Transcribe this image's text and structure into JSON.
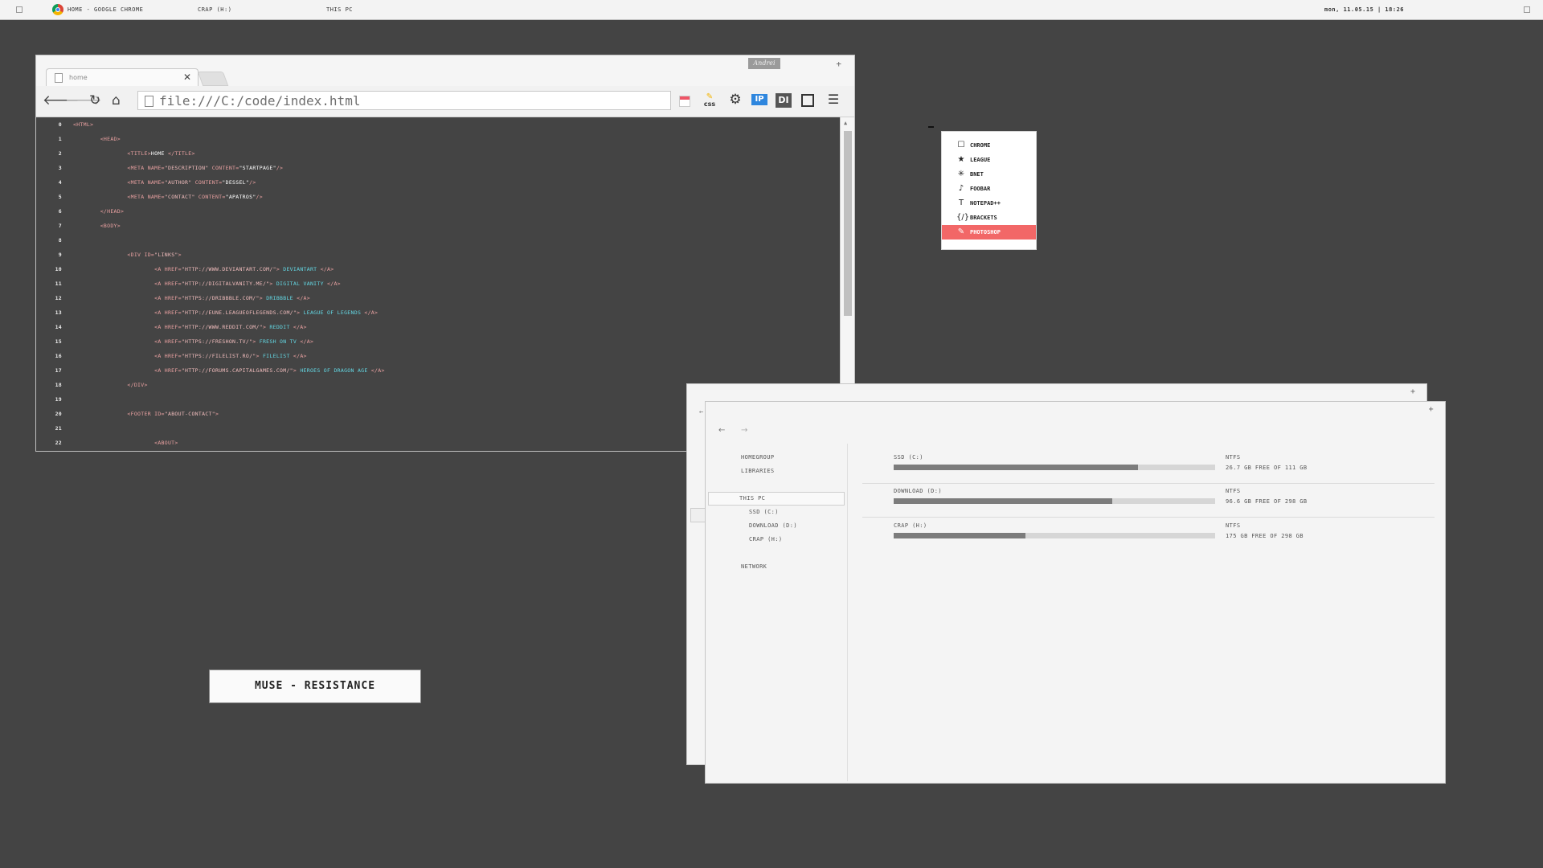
{
  "taskbar": {
    "active_window": "HOME - GOOGLE CHROME",
    "items": [
      "CRAP (H:)",
      "THIS PC"
    ],
    "datetime": "mon, 11.05.15 | 18:26"
  },
  "browser": {
    "tab_title": "home",
    "user_button": "Andrei",
    "url": "file:///C:/code/index.html",
    "extensions": [
      "calendar-icon",
      "css-icon",
      "gear-icon",
      "ip-icon",
      "di-icon",
      "fullscreen-icon",
      "menu-icon"
    ]
  },
  "editor": {
    "lines": [
      {
        "n": "0",
        "segments": [
          {
            "t": "<HTML>",
            "c": "tag"
          }
        ]
      },
      {
        "n": "1",
        "segments": [
          {
            "t": "        <HEAD>",
            "c": "tag"
          }
        ]
      },
      {
        "n": "2",
        "segments": [
          {
            "t": "                <TITLE>",
            "c": "tag"
          },
          {
            "t": "HOME",
            "c": "txt"
          },
          {
            "t": " </TITLE>",
            "c": "tag"
          }
        ]
      },
      {
        "n": "3",
        "segments": [
          {
            "t": "                <META NAME=",
            "c": "tag"
          },
          {
            "t": "\"DESCRIPTION\"",
            "c": "str"
          },
          {
            "t": " CONTENT=",
            "c": "tag"
          },
          {
            "t": "\"STARTPAGE\"",
            "c": "txt"
          },
          {
            "t": "/>",
            "c": "tag"
          }
        ]
      },
      {
        "n": "4",
        "segments": [
          {
            "t": "                <META NAME=",
            "c": "tag"
          },
          {
            "t": "\"AUTHOR\"",
            "c": "str"
          },
          {
            "t": " CONTENT=",
            "c": "tag"
          },
          {
            "t": "\"DESSEL\"",
            "c": "txt"
          },
          {
            "t": "/>",
            "c": "tag"
          }
        ]
      },
      {
        "n": "5",
        "segments": [
          {
            "t": "                <META NAME=",
            "c": "tag"
          },
          {
            "t": "\"CONTACT\"",
            "c": "str"
          },
          {
            "t": " CONTENT=",
            "c": "tag"
          },
          {
            "t": "\"APATROS\"",
            "c": "txt"
          },
          {
            "t": "/>",
            "c": "tag"
          }
        ]
      },
      {
        "n": "6",
        "segments": [
          {
            "t": "        </HEAD>",
            "c": "tag"
          }
        ]
      },
      {
        "n": "7",
        "segments": [
          {
            "t": "        <BODY>",
            "c": "tag"
          }
        ]
      },
      {
        "n": "8",
        "segments": []
      },
      {
        "n": "9",
        "segments": [
          {
            "t": "                <DIV ID=",
            "c": "tag"
          },
          {
            "t": "\"LINKS\"",
            "c": "str"
          },
          {
            "t": ">",
            "c": "tag"
          }
        ]
      },
      {
        "n": "10",
        "segments": [
          {
            "t": "                        <A HREF=",
            "c": "tag"
          },
          {
            "t": "\"HTTP://WWW.DEVIANTART.COM/\"",
            "c": "str"
          },
          {
            "t": "> ",
            "c": "tag"
          },
          {
            "t": "DEVIANTART",
            "c": "link"
          },
          {
            "t": " </A>",
            "c": "tag"
          }
        ]
      },
      {
        "n": "11",
        "segments": [
          {
            "t": "                        <A HREF=",
            "c": "tag"
          },
          {
            "t": "\"HTTP://DIGITALVANITY.ME/\"",
            "c": "str"
          },
          {
            "t": "> ",
            "c": "tag"
          },
          {
            "t": "DIGITAL VANITY",
            "c": "link"
          },
          {
            "t": " </A>",
            "c": "tag"
          }
        ]
      },
      {
        "n": "12",
        "segments": [
          {
            "t": "                        <A HREF=",
            "c": "tag"
          },
          {
            "t": "\"HTTPS://DRIBBBLE.COM/\"",
            "c": "str"
          },
          {
            "t": "> ",
            "c": "tag"
          },
          {
            "t": "DRIBBBLE",
            "c": "link"
          },
          {
            "t": " </A>",
            "c": "tag"
          }
        ]
      },
      {
        "n": "13",
        "segments": [
          {
            "t": "                        <A HREF=",
            "c": "tag"
          },
          {
            "t": "\"HTTP://EUNE.LEAGUEOFLEGENDS.COM/\"",
            "c": "str"
          },
          {
            "t": "> ",
            "c": "tag"
          },
          {
            "t": "LEAGUE OF LEGENDS",
            "c": "link"
          },
          {
            "t": " </A>",
            "c": "tag"
          }
        ]
      },
      {
        "n": "14",
        "segments": [
          {
            "t": "                        <A HREF=",
            "c": "tag"
          },
          {
            "t": "\"HTTP://WWW.REDDIT.COM/\"",
            "c": "str"
          },
          {
            "t": "> ",
            "c": "tag"
          },
          {
            "t": "REDDIT",
            "c": "link"
          },
          {
            "t": " </A>",
            "c": "tag"
          }
        ]
      },
      {
        "n": "15",
        "segments": [
          {
            "t": "                        <A HREF=",
            "c": "tag"
          },
          {
            "t": "\"HTTPS://FRESHON.TV/\"",
            "c": "str"
          },
          {
            "t": "> ",
            "c": "tag"
          },
          {
            "t": "FRESH ON TV",
            "c": "link"
          },
          {
            "t": " </A>",
            "c": "tag"
          }
        ]
      },
      {
        "n": "16",
        "segments": [
          {
            "t": "                        <A HREF=",
            "c": "tag"
          },
          {
            "t": "\"HTTPS://FILELIST.RO/\"",
            "c": "str"
          },
          {
            "t": "> ",
            "c": "tag"
          },
          {
            "t": "FILELIST",
            "c": "link"
          },
          {
            "t": " </A>",
            "c": "tag"
          }
        ]
      },
      {
        "n": "17",
        "segments": [
          {
            "t": "                        <A HREF=",
            "c": "tag"
          },
          {
            "t": "\"HTTP://FORUMS.CAPITALGAMES.COM/\"",
            "c": "str"
          },
          {
            "t": "> ",
            "c": "tag"
          },
          {
            "t": "HEROES OF DRAGON AGE",
            "c": "link"
          },
          {
            "t": " </A>",
            "c": "tag"
          }
        ]
      },
      {
        "n": "18",
        "segments": [
          {
            "t": "                </DIV>",
            "c": "tag"
          }
        ]
      },
      {
        "n": "19",
        "segments": []
      },
      {
        "n": "20",
        "segments": [
          {
            "t": "                <FOOTER ID=",
            "c": "tag"
          },
          {
            "t": "\"ABOUT-CONTACT\"",
            "c": "str"
          },
          {
            "t": ">",
            "c": "tag"
          }
        ]
      },
      {
        "n": "21",
        "segments": []
      },
      {
        "n": "22",
        "segments": [
          {
            "t": "                        <ABOUT>",
            "c": "tag"
          }
        ]
      }
    ]
  },
  "launcher": {
    "items": [
      {
        "label": "CHROME",
        "icon": "square-icon",
        "glyph": "☐",
        "active": false
      },
      {
        "label": "LEAGUE",
        "icon": "star-icon",
        "glyph": "★",
        "active": false
      },
      {
        "label": "BNET",
        "icon": "bnet-icon",
        "glyph": "✳",
        "active": false
      },
      {
        "label": "FOOBAR",
        "icon": "music-note-icon",
        "glyph": "♪",
        "active": false
      },
      {
        "label": "NOTEPAD++",
        "icon": "text-icon",
        "glyph": "T",
        "active": false
      },
      {
        "label": "BRACKETS",
        "icon": "code-icon",
        "glyph": "{/}",
        "active": false
      },
      {
        "label": "PHOTOSHOP",
        "icon": "pencil-icon",
        "glyph": "✎",
        "active": true
      }
    ],
    "active_color": "#f26767"
  },
  "explorer": {
    "sidebar": {
      "homegroup": "HOMEGROUP",
      "libraries": "LIBRARIES",
      "this_pc": "THIS PC",
      "drives": [
        "SSD (C:)",
        "DOWNLOAD (D:)",
        "CRAP (H:)"
      ],
      "network": "NETWORK"
    },
    "drives": [
      {
        "name": "SSD (C:)",
        "fs": "NTFS",
        "free": "26.7 GB FREE OF 111 GB",
        "used_fraction": 0.76
      },
      {
        "name": "DOWNLOAD (D:)",
        "fs": "NTFS",
        "free": "96.6 GB FREE OF 298 GB",
        "used_fraction": 0.68
      },
      {
        "name": "CRAP (H:)",
        "fs": "NTFS",
        "free": "175 GB FREE OF 298 GB",
        "used_fraction": 0.41
      }
    ]
  },
  "nowplaying": {
    "track": "MUSE - RESISTANCE"
  },
  "colors": {
    "desktop": "#444444",
    "tag": "#e8a0a0",
    "link": "#63d7e3",
    "bar_fill": "#7c7c7c"
  }
}
